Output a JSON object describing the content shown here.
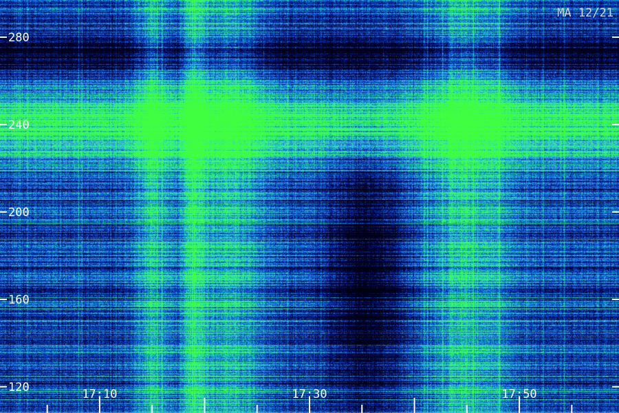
{
  "chart_data": {
    "type": "heatmap",
    "title": "MA 12/21",
    "xlabel": "",
    "ylabel": "",
    "x_tick_labels": [
      "17:10",
      "17:30",
      "17:50"
    ],
    "x_tick_values_min": [
      10,
      30,
      50
    ],
    "x_range_min": [
      0.5,
      59.5
    ],
    "y_tick_values": [
      120,
      160,
      200,
      240,
      280
    ],
    "y_range": [
      108,
      297
    ],
    "grid": false,
    "colormap": [
      "#000014",
      "#000a55",
      "#0a3cc8",
      "#1a8fe0",
      "#2be8a0",
      "#40ff40"
    ],
    "intensity_features": [
      {
        "kind": "horizontal_band",
        "y_center": 240,
        "y_halfwidth": 12,
        "strength": 0.55
      },
      {
        "kind": "vertical_band",
        "x_center_min": 15,
        "x_halfwidth_min": 1.2,
        "strength": 0.35
      },
      {
        "kind": "vertical_band",
        "x_center_min": 19,
        "x_halfwidth_min": 0.8,
        "strength": 0.4
      },
      {
        "kind": "vertical_band",
        "x_center_min": 22.5,
        "x_halfwidth_min": 2.5,
        "strength": 0.3
      },
      {
        "kind": "vertical_band",
        "x_center_min": 45,
        "x_halfwidth_min": 3,
        "strength": 0.35
      },
      {
        "kind": "dark_patch",
        "x_center_min": 35.5,
        "x_halfwidth_min": 2.5,
        "y_center": 170,
        "y_halfwidth": 45,
        "strength": 0.45
      },
      {
        "kind": "dark_band",
        "y_center": 272,
        "y_halfwidth": 6,
        "strength": 0.35
      }
    ]
  }
}
